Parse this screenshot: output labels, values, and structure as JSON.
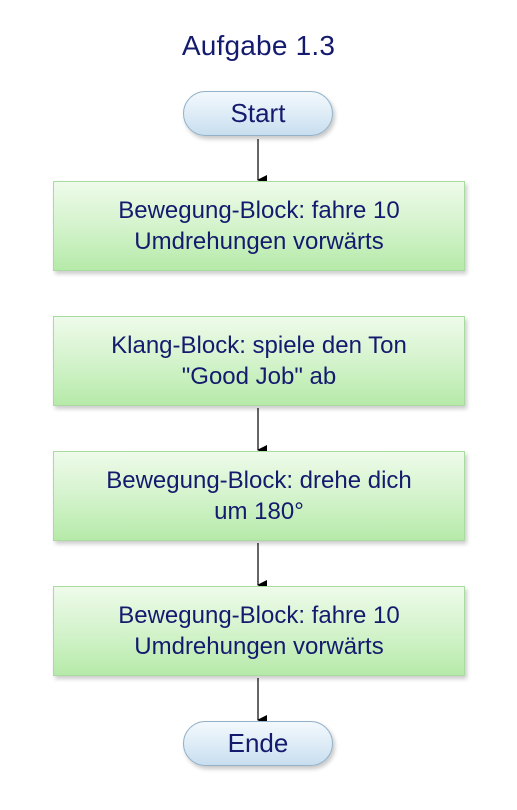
{
  "title": "Aufgabe 1.3",
  "nodes": {
    "start": "Start",
    "step1": {
      "line1": "Bewegung-Block: fahre 10",
      "line2": "Umdrehungen vorwärts"
    },
    "step2": {
      "line1": "Klang-Block: spiele den Ton",
      "line2": "\"Good Job\" ab"
    },
    "step3": {
      "line1": "Bewegung-Block: drehe dich",
      "line2": "um 180°"
    },
    "step4": {
      "line1": "Bewegung-Block: fahre 10",
      "line2": "Umdrehungen vorwärts"
    },
    "end": "Ende"
  },
  "colors": {
    "text": "#141a6e",
    "terminal_fill": "#dcebf6",
    "process_fill": "#d4f3cc",
    "arrow": "#000000"
  }
}
